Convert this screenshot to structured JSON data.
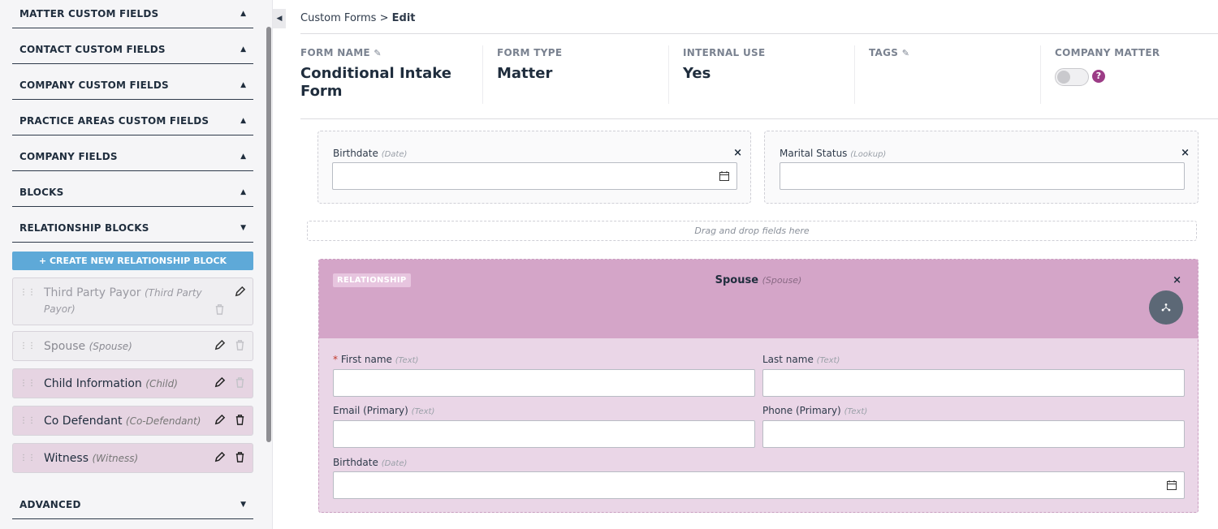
{
  "sidebar": {
    "sections": [
      {
        "label": "MATTER CUSTOM FIELDS",
        "arrow": "▲"
      },
      {
        "label": "CONTACT CUSTOM FIELDS",
        "arrow": "▲"
      },
      {
        "label": "COMPANY CUSTOM FIELDS",
        "arrow": "▲"
      },
      {
        "label": "PRACTICE AREAS CUSTOM FIELDS",
        "arrow": "▲"
      },
      {
        "label": "COMPANY FIELDS",
        "arrow": "▲"
      },
      {
        "label": "BLOCKS",
        "arrow": "▲"
      },
      {
        "label": "RELATIONSHIP BLOCKS",
        "arrow": "▼"
      }
    ],
    "create_button": "+ CREATE NEW RELATIONSHIP BLOCK",
    "relationship_blocks": [
      {
        "name": "Third Party Payor",
        "sub": "(Third Party Payor)"
      },
      {
        "name": "Spouse",
        "sub": "(Spouse)"
      },
      {
        "name": "Child Information",
        "sub": "(Child)"
      },
      {
        "name": "Co Defendant",
        "sub": "(Co-Defendant)"
      },
      {
        "name": "Witness",
        "sub": "(Witness)"
      }
    ],
    "advanced": {
      "label": "ADVANCED",
      "arrow": "▼"
    }
  },
  "breadcrumb": {
    "parent": "Custom Forms",
    "separator": ">",
    "current": "Edit"
  },
  "meta": {
    "form_name": {
      "label": "FORM NAME",
      "value": "Conditional Intake Form"
    },
    "form_type": {
      "label": "FORM TYPE",
      "value": "Matter"
    },
    "internal_use": {
      "label": "INTERNAL USE",
      "value": "Yes"
    },
    "tags": {
      "label": "TAGS"
    },
    "company_matter": {
      "label": "COMPANY MATTER",
      "help": "?",
      "toggle_on": false
    }
  },
  "fields": {
    "birthdate": {
      "label": "Birthdate",
      "type": "(Date)",
      "close": "×"
    },
    "marital_status": {
      "label": "Marital Status",
      "type": "(Lookup)",
      "close": "×"
    }
  },
  "dropzone": "Drag and drop fields here",
  "relationship": {
    "badge": "RELATIONSHIP",
    "title": "Spouse",
    "title_sub": "(Spouse)",
    "close": "×",
    "fields": {
      "first_name": {
        "label": "First name",
        "type": "(Text)",
        "required": "*"
      },
      "last_name": {
        "label": "Last name",
        "type": "(Text)"
      },
      "email": {
        "label": "Email (Primary)",
        "type": "(Text)"
      },
      "phone": {
        "label": "Phone (Primary)",
        "type": "(Text)"
      },
      "birthdate": {
        "label": "Birthdate",
        "type": "(Date)"
      }
    }
  },
  "colors": {
    "accent_blue": "#5ea9d8",
    "relationship_header": "#d4a5c8",
    "relationship_body": "#ead6e7",
    "help_purple": "#9c3c86"
  }
}
